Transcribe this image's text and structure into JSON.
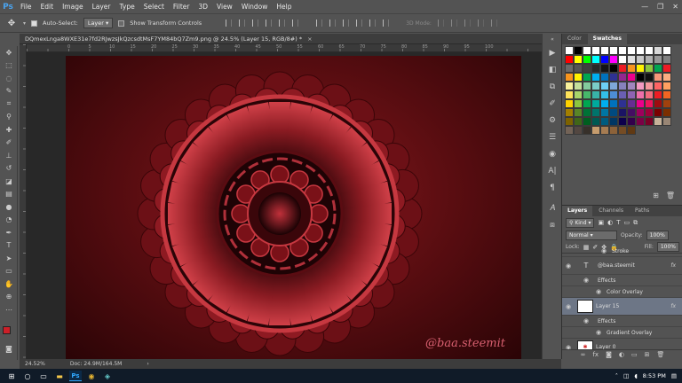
{
  "app": {
    "logo": "Ps"
  },
  "menu": [
    "File",
    "Edit",
    "Image",
    "Layer",
    "Type",
    "Select",
    "Filter",
    "3D",
    "View",
    "Window",
    "Help"
  ],
  "window_controls": [
    "—",
    "❐",
    "✕"
  ],
  "options_bar": {
    "auto_select_label": "Auto-Select:",
    "auto_select_value": "Layer",
    "transform_label": "Show Transform Controls",
    "mode3d_label": "3D Mode:"
  },
  "document": {
    "tab_title": "DQmexLnga8WXE31e7fd2RJwzsJkQzcsdtMsF7YM84bQ7Zm9.png @ 24.5% (Layer 15, RGB/8#) *",
    "ruler_numbers": [
      "0",
      "5",
      "10",
      "15",
      "20",
      "25",
      "30",
      "35",
      "40",
      "45",
      "50",
      "55",
      "60",
      "65",
      "70",
      "75",
      "80",
      "85",
      "90",
      "95",
      "100"
    ],
    "watermark": "@baa.steemit"
  },
  "status": {
    "zoom": "24.52%",
    "doc_size": "Doc: 24.9M/164.5M"
  },
  "panel_tabs": {
    "color": "Color",
    "swatches": "Swatches"
  },
  "swatches": [
    "#ffffff",
    "#000000",
    "#ffffff",
    "#ffffff",
    "#ffffff",
    "#ffffff",
    "#ffffff",
    "#ffffff",
    "#ffffff",
    "#ffffff",
    "#d8d8d8",
    "#ffffff",
    "#ff0000",
    "#ffff00",
    "#00ff00",
    "#00ffff",
    "#0000ff",
    "#ff00ff",
    "#ffffff",
    "#e0e0e0",
    "#c8c8c8",
    "#b0b0b0",
    "#989898",
    "#808080",
    "#6a6a6a",
    "#545454",
    "#3e3e3e",
    "#282828",
    "#141414",
    "#000000",
    "#ed1c24",
    "#f7941d",
    "#fff200",
    "#8dc63f",
    "#00a651",
    "#ed1c24",
    "#f7941d",
    "#fff200",
    "#00a651",
    "#00aeef",
    "#0072bc",
    "#2e3192",
    "#92278f",
    "#ec008c",
    "#000000",
    "#111111",
    "#f69679",
    "#fbad82",
    "#f9f19c",
    "#c4df9b",
    "#82ca9c",
    "#7accc8",
    "#6dcff6",
    "#7ea7d8",
    "#8781bd",
    "#a186be",
    "#f49ac1",
    "#f6989d",
    "#ff6464",
    "#ffa060",
    "#ffe25a",
    "#a8d46a",
    "#47b86a",
    "#38b2a8",
    "#33bde8",
    "#4d8ed6",
    "#6a5fb3",
    "#8e63b2",
    "#ee6fa9",
    "#f26c7d",
    "#ed1c24",
    "#f26522",
    "#ffd200",
    "#8cc63f",
    "#00a651",
    "#00a99d",
    "#00aeef",
    "#0072bc",
    "#2e3192",
    "#662d91",
    "#ec008c",
    "#ed145b",
    "#9e0b0f",
    "#a0410d",
    "#a37f00",
    "#598527",
    "#007236",
    "#00746b",
    "#0076a3",
    "#004a80",
    "#1b1464",
    "#440e62",
    "#9e005d",
    "#9e0039",
    "#790000",
    "#7b2e00",
    "#7d6200",
    "#406618",
    "#005e20",
    "#005952",
    "#005b7f",
    "#003663",
    "#0d004c",
    "#32004b",
    "#7b0046",
    "#7a0026",
    "#c7b299",
    "#998675",
    "#736357",
    "#534741",
    "#37302a",
    "#c69c6d",
    "#a67c52",
    "#8c6239",
    "#754c24",
    "#603913"
  ],
  "layers_panel": {
    "tabs": [
      "Layers",
      "Channels",
      "Paths"
    ],
    "kind_label": "Kind",
    "blend_mode": "Normal",
    "opacity_label": "Opacity:",
    "opacity_value": "100%",
    "lock_label": "Lock:",
    "fill_label": "Fill:",
    "fill_value": "100%",
    "items": [
      {
        "name": "Stroke",
        "type": "effect"
      },
      {
        "name": "@baa.steemit",
        "type": "text",
        "fx": "fx"
      },
      {
        "name": "Effects",
        "type": "effects"
      },
      {
        "name": "Color Overlay",
        "type": "effect"
      },
      {
        "name": "Layer 15",
        "type": "layer",
        "fx": "fx"
      },
      {
        "name": "Effects",
        "type": "effects"
      },
      {
        "name": "Gradient Overlay",
        "type": "effect"
      },
      {
        "name": "Layer 0",
        "type": "layer"
      }
    ]
  },
  "taskbar": {
    "time": "8:53 PM"
  },
  "colors": {
    "foreground": "#cc1f28",
    "background": "#ffffff",
    "accent": "#31a8ff"
  }
}
